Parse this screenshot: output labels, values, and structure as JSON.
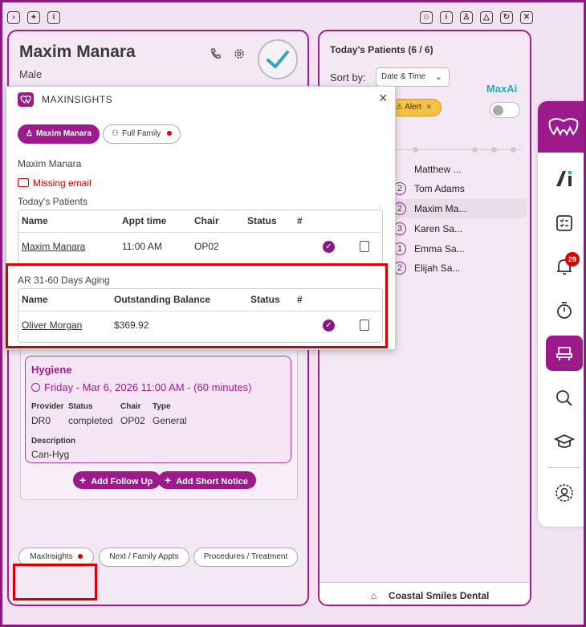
{
  "patient": {
    "name": "Maxim Manara",
    "gender": "Male"
  },
  "appointment": {
    "title": "Hygiene",
    "datetime": "Friday - Mar 6, 2026 11:00 AM - (60 minutes)",
    "labels": {
      "provider": "Provider",
      "status": "Status",
      "chair": "Chair",
      "type": "Type",
      "description": "Description"
    },
    "provider": "DR0",
    "status": "completed",
    "chair": "OP02",
    "type": "General",
    "description": "Can-Hyg"
  },
  "buttons": {
    "add_follow_up": "Add Follow Up",
    "add_short_notice": "Add Short Notice"
  },
  "bottom_tabs": {
    "maxinsights": "MaxInsights",
    "next_family": "Next / Family Appts",
    "procedures": "Procedures / Treatment"
  },
  "patients_panel": {
    "title": "Today's Patients (6 / 6)",
    "sort_label": "Sort by:",
    "sort_value": "Date & Time",
    "maxai_label": "MaxAi",
    "alert_label": "Alert",
    "patients": [
      {
        "num": "",
        "name": "Matthew ..."
      },
      {
        "num": "2",
        "name": "Tom Adams"
      },
      {
        "num": "2",
        "name": "Maxim Ma..."
      },
      {
        "num": "3",
        "name": "Karen Sa..."
      },
      {
        "num": "1",
        "name": "Emma Sa..."
      },
      {
        "num": "2",
        "name": "Elijah Sa..."
      }
    ],
    "footer": "Coastal Smiles Dental"
  },
  "rail": {
    "notification_count": "29"
  },
  "modal": {
    "title": "MAXINSIGHTS",
    "filter_patient": "Maxim Manara",
    "filter_family": "Full Family",
    "patient_name": "Maxim Manara",
    "missing_email": "Missing email",
    "todays_patients_title": "Today's Patients",
    "todays_headers": {
      "name": "Name",
      "appt_time": "Appt time",
      "chair": "Chair",
      "status": "Status",
      "hash": "#"
    },
    "todays_row": {
      "name": "Maxim Manara",
      "appt_time": "11:00 AM",
      "chair": "OP02"
    },
    "ar_title": "AR 31-60 Days Aging",
    "ar_headers": {
      "name": "Name",
      "balance": "Outstanding Balance",
      "status": "Status",
      "hash": "#"
    },
    "ar_row": {
      "name": "Oliver Morgan",
      "balance": "$369.92"
    }
  },
  "colors": {
    "brand": "#9c1a8c",
    "highlight": "#d80000",
    "alert": "#f7c244"
  }
}
